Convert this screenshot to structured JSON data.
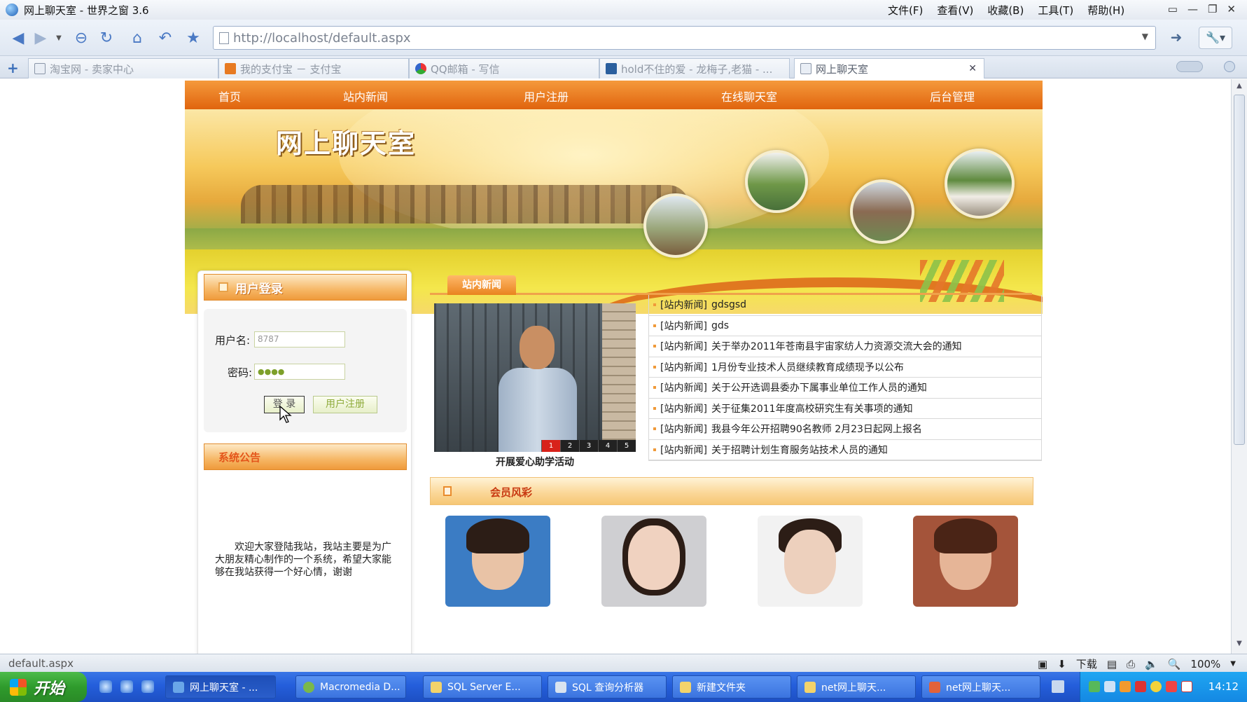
{
  "window": {
    "title": "网上聊天室 - 世界之窗 3.6",
    "menu": [
      "文件(F)",
      "查看(V)",
      "收藏(B)",
      "工具(T)",
      "帮助(H)"
    ],
    "controls": [
      "▭",
      "—",
      "❐",
      "✕"
    ]
  },
  "toolbar": {
    "url": "http://localhost/default.aspx"
  },
  "tabs": [
    {
      "label": "淘宝网 - 卖家中心",
      "icon_color": "#e9eef5"
    },
    {
      "label": "我的支付宝 － 支付宝",
      "icon_color": "#e77a22"
    },
    {
      "label": "QQ邮箱 - 写信",
      "icon_color": "#3a9a3a"
    },
    {
      "label": "hold不住的爱 - 龙梅子,老猫 - ...",
      "icon_color": "#2a5f9e"
    },
    {
      "label": "网上聊天室",
      "icon_color": "#e9eef5",
      "active": true
    }
  ],
  "site": {
    "nav": [
      "首页",
      "站内新闻",
      "用户注册",
      "在线聊天室",
      "后台管理"
    ],
    "banner_title": "网上聊天室",
    "login": {
      "title": "用户登录",
      "username_label": "用户名:",
      "username_value": "8787",
      "password_label": "密码:",
      "password_value": "●●●●",
      "login_button": "登 录",
      "register_button": "用户注册"
    },
    "notice": {
      "title": "系统公告",
      "text": "欢迎大家登陆我站，我站主要是为广大朋友精心制作的一个系统，希望大家能够在我站获得一个好心情，谢谢"
    },
    "news": {
      "tab_label": "站内新闻",
      "photo_caption": "开展爱心助学活动",
      "slides": [
        "1",
        "2",
        "3",
        "4",
        "5"
      ],
      "active_slide": "1",
      "items": [
        {
          "tag": "[站内新闻]",
          "title": "gdsgsd"
        },
        {
          "tag": "[站内新闻]",
          "title": "gds"
        },
        {
          "tag": "[站内新闻]",
          "title": "关于举办2011年苍南县宇宙家纺人力资源交流大会的通知"
        },
        {
          "tag": "[站内新闻]",
          "title": "1月份专业技术人员继续教育成绩现予以公布"
        },
        {
          "tag": "[站内新闻]",
          "title": "关于公开选调县委办下属事业单位工作人员的通知"
        },
        {
          "tag": "[站内新闻]",
          "title": "关于征集2011年度高校研究生有关事项的通知"
        },
        {
          "tag": "[站内新闻]",
          "title": "我县今年公开招聘90名教师 2月23日起网上报名"
        },
        {
          "tag": "[站内新闻]",
          "title": "关于招聘计划生育服务站技术人员的通知"
        }
      ]
    },
    "members": {
      "title": "会员风彩",
      "photos": [
        {
          "bg": "#3b7cc4",
          "shirt": "#2b6fb8"
        },
        {
          "bg": "#cfcfd2",
          "shirt": "#e0c9b5"
        },
        {
          "bg": "#f2f2f2",
          "shirt": "#333333"
        },
        {
          "bg": "#a4543a",
          "shirt": "#c06a4a"
        }
      ]
    }
  },
  "statusbar": {
    "text": "default.aspx",
    "download_label": "下载",
    "zoom": "100%"
  },
  "taskbar": {
    "start_label": "开始",
    "windows": [
      {
        "label": "网上聊天室 - ...",
        "active": true
      },
      {
        "label": "Macromedia D...",
        "active": false
      },
      {
        "label": "SQL Server E...",
        "active": false
      },
      {
        "label": "SQL 查询分析器",
        "active": false
      },
      {
        "label": "新建文件夹",
        "active": false
      },
      {
        "label": "net网上聊天...",
        "active": false
      },
      {
        "label": "net网上聊天...",
        "active": false
      }
    ],
    "clock": "14:12"
  }
}
